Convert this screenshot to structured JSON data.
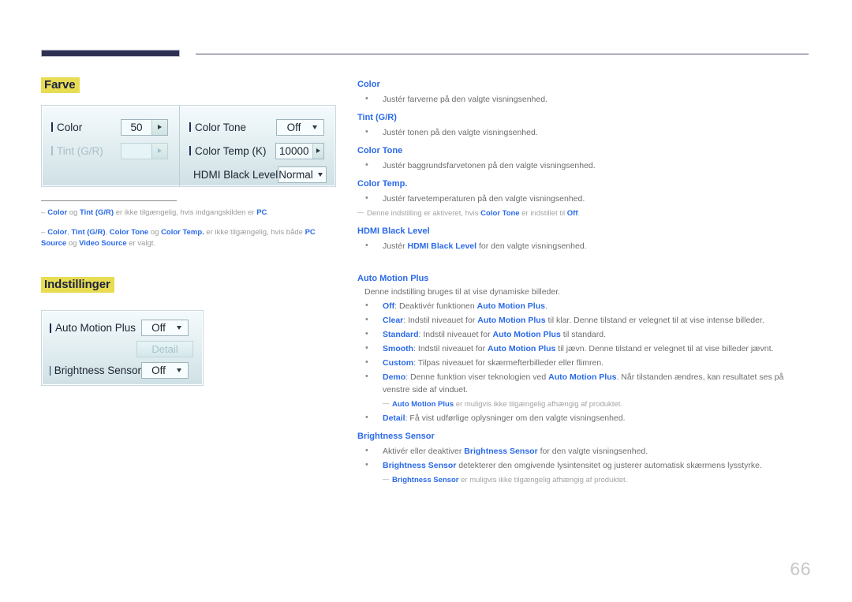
{
  "page": {
    "number": "66",
    "accent_blue": "#2b6ae8",
    "highlight_yellow": "#e8dc52",
    "header_navy": "#2d3050"
  },
  "sections": [
    {
      "id": "farve",
      "heading": "Farve"
    },
    {
      "id": "indstillinger",
      "heading": "Indstillinger"
    }
  ],
  "osd_color": {
    "left_rows": [
      {
        "label": "Color",
        "value": "50",
        "control": "spinner",
        "disabled": false
      },
      {
        "label": "Tint (G/R)",
        "value": "",
        "control": "spinner",
        "disabled": true
      }
    ],
    "right_rows": [
      {
        "label": "Color Tone",
        "value": "Off",
        "control": "select",
        "disabled": false
      },
      {
        "label": "Color Temp (K)",
        "value": "10000",
        "control": "spinner",
        "disabled": false
      },
      {
        "label": "HDMI Black Level",
        "value": "Normal",
        "control": "select",
        "disabled": false
      }
    ]
  },
  "osd_color_notes": [
    {
      "html": "<b>Color</b> og <b>Tint (G/R)</b> er ikke tilgængelig, hvis indgangskilden er <b>PC</b>."
    },
    {
      "html": "<b>Color</b>, <b>Tint (G/R)</b>, <b>Color Tone</b> og <b>Color Temp.</b> er ikke tilgængelig, hvis både <b>PC Source</b> og <b>Video Source</b> er valgt."
    }
  ],
  "osd_settings": {
    "rows": [
      {
        "label": "Auto Motion Plus",
        "value": "Off",
        "control": "select",
        "disabled": false
      },
      {
        "label": "Detail",
        "value": "Detail",
        "control": "button",
        "disabled": true
      },
      {
        "label": "Brightness Sensor",
        "value": "Off",
        "control": "select",
        "disabled": false
      }
    ]
  },
  "right_column": {
    "blocks": [
      {
        "type": "term",
        "text": "Color"
      },
      {
        "type": "bullet",
        "html": "Justér farverne på den valgte visningsenhed."
      },
      {
        "type": "term",
        "text": "Tint (G/R)"
      },
      {
        "type": "bullet",
        "html": "Justér tonen på den valgte visningsenhed."
      },
      {
        "type": "term",
        "text": "Color Tone"
      },
      {
        "type": "bullet",
        "html": "Justér baggrundsfarvetonen på den valgte visningsenhed."
      },
      {
        "type": "term",
        "text": "Color Temp."
      },
      {
        "type": "bullet",
        "html": "Justér farvetemperaturen på den valgte visningsenhed."
      },
      {
        "type": "subnote",
        "html": "Denne indstilling er aktiveret, hvis <b>Color Tone</b> er indstillet til <b>Off</b>."
      },
      {
        "type": "term",
        "text": "HDMI Black Level"
      },
      {
        "type": "bullet",
        "html": "Justér <b>HDMI Black Level</b> for den valgte visningsenhed."
      },
      {
        "type": "gap"
      },
      {
        "type": "term",
        "text": "Auto Motion Plus"
      },
      {
        "type": "plain",
        "html": "Denne indstilling bruges til at vise dynamiske billeder."
      },
      {
        "type": "bullet",
        "html": "<b>Off</b>: Deaktivér funktionen <b>Auto Motion Plus</b>."
      },
      {
        "type": "bullet",
        "html": "<b>Clear</b>: Indstil niveauet for <b>Auto Motion Plus</b> til klar. Denne tilstand er velegnet til at vise intense billeder."
      },
      {
        "type": "bullet",
        "html": "<b>Standard</b>: Indstil niveauet for <b>Auto Motion Plus</b> til standard."
      },
      {
        "type": "bullet",
        "html": "<b>Smooth</b>: Indstil niveauet for <b>Auto Motion Plus</b> til jævn. Denne tilstand er velegnet til at vise billeder jævnt."
      },
      {
        "type": "bullet",
        "html": "<b>Custom</b>: Tilpas niveauet for skærmefterbilleder eller flimren."
      },
      {
        "type": "bullet",
        "html": "<b>Demo</b>: Denne funktion viser teknologien ved <b>Auto Motion Plus</b>. Når tilstanden ændres, kan resultatet ses på venstre side af vinduet."
      },
      {
        "type": "subnote-indented",
        "html": "<b>Auto Motion Plus</b> er muligvis ikke tilgængelig afhængig af produktet."
      },
      {
        "type": "bullet",
        "html": "<b>Detail</b>: Få vist udførlige oplysninger om den valgte visningsenhed."
      },
      {
        "type": "term",
        "text": "Brightness Sensor"
      },
      {
        "type": "bullet",
        "html": "Aktivér eller deaktiver <b>Brightness Sensor</b> for den valgte visningsenhed."
      },
      {
        "type": "bullet",
        "html": "<b>Brightness Sensor</b> detekterer den omgivende lysintensitet og justerer automatisk skærmens lysstyrke."
      },
      {
        "type": "subnote-indented",
        "html": "<b>Brightness Sensor</b> er muligvis ikke tilgængelig afhængig af produktet."
      }
    ]
  }
}
